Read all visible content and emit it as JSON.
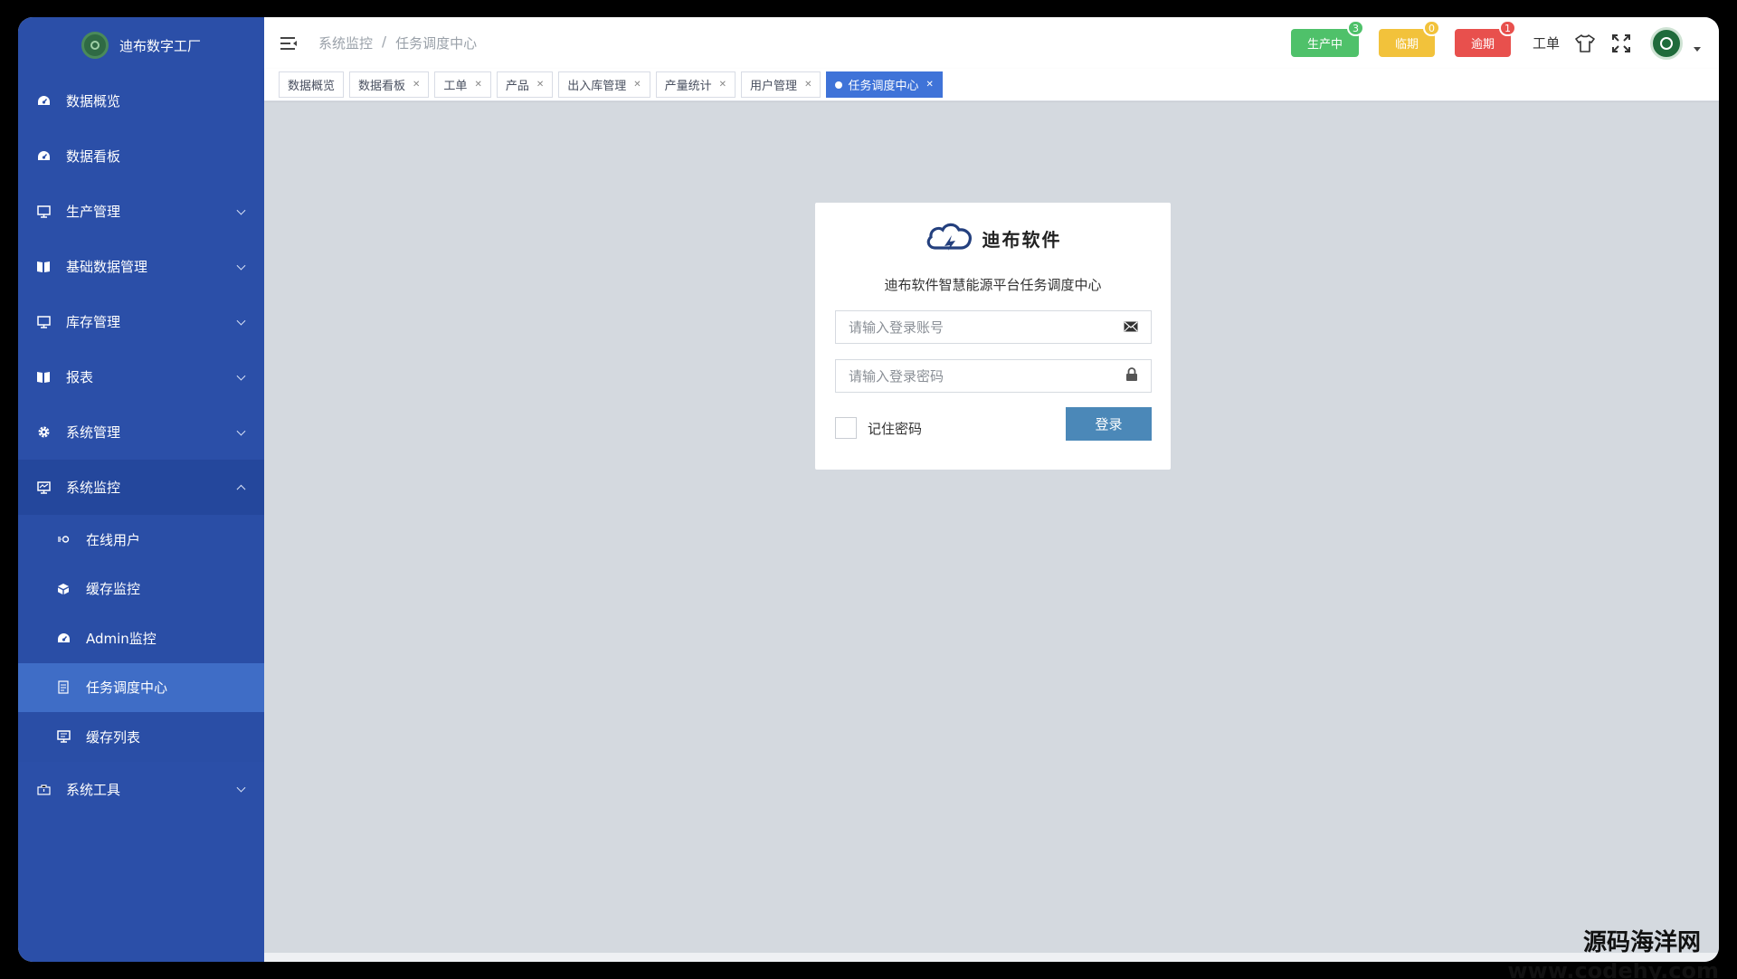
{
  "app": {
    "brand_name": "迪布数字工厂"
  },
  "sidebar": {
    "items": [
      {
        "label": "数据概览",
        "icon": "dashboard-icon"
      },
      {
        "label": "数据看板",
        "icon": "dashboard-icon"
      },
      {
        "label": "生产管理",
        "icon": "monitor-icon",
        "expandable": true
      },
      {
        "label": "基础数据管理",
        "icon": "book-icon",
        "expandable": true
      },
      {
        "label": "库存管理",
        "icon": "monitor-icon",
        "expandable": true
      },
      {
        "label": "报表",
        "icon": "book-icon",
        "expandable": true
      },
      {
        "label": "系统管理",
        "icon": "gear-icon",
        "expandable": true
      },
      {
        "label": "系统监控",
        "icon": "monitor-icon",
        "expandable": true,
        "expanded": true
      },
      {
        "label": "系统工具",
        "icon": "toolbox-icon",
        "expandable": true
      }
    ],
    "submenu": [
      {
        "label": "在线用户",
        "icon": "online-icon"
      },
      {
        "label": "缓存监控",
        "icon": "cube-icon"
      },
      {
        "label": "Admin监控",
        "icon": "dashboard-icon"
      },
      {
        "label": "任务调度中心",
        "icon": "job-icon",
        "active": true
      },
      {
        "label": "缓存列表",
        "icon": "monitor-icon"
      }
    ]
  },
  "header": {
    "breadcrumb": [
      "系统监控",
      "任务调度中心"
    ],
    "breadcrumb_sep": "/",
    "status_buttons": [
      {
        "label": "生产中",
        "count": "3",
        "color": "#4fc16a",
        "badge_color": "#4fc16a"
      },
      {
        "label": "临期",
        "count": "0",
        "color": "#f2c23b",
        "badge_color": "#f2c23b"
      },
      {
        "label": "逾期",
        "count": "1",
        "color": "#e8504d",
        "badge_color": "#e8504d"
      }
    ],
    "work_order_label": "工单",
    "icons": [
      "shirt-icon",
      "fullscreen-icon"
    ]
  },
  "tags": [
    {
      "label": "数据概览",
      "closable": false
    },
    {
      "label": "数据看板",
      "closable": true
    },
    {
      "label": "工单",
      "closable": true
    },
    {
      "label": "产品",
      "closable": true
    },
    {
      "label": "出入库管理",
      "closable": true
    },
    {
      "label": "产量统计",
      "closable": true
    },
    {
      "label": "用户管理",
      "closable": true
    },
    {
      "label": "任务调度中心",
      "closable": true,
      "active": true
    }
  ],
  "login": {
    "brand_name": "迪布软件",
    "subtitle": "迪布软件智慧能源平台任务调度中心",
    "account_placeholder": "请输入登录账号",
    "password_placeholder": "请输入登录密码",
    "remember_label": "记住密码",
    "login_button": "登录"
  },
  "watermark": {
    "text": "源码海洋网",
    "url": "www.codehy.com"
  },
  "colors": {
    "sidebar_bg": "#2b4fa8",
    "sidebar_active": "#3f6dc6",
    "tag_active": "#3f73d8",
    "login_button": "#4b88b8",
    "content_bg": "#d4d9df"
  }
}
